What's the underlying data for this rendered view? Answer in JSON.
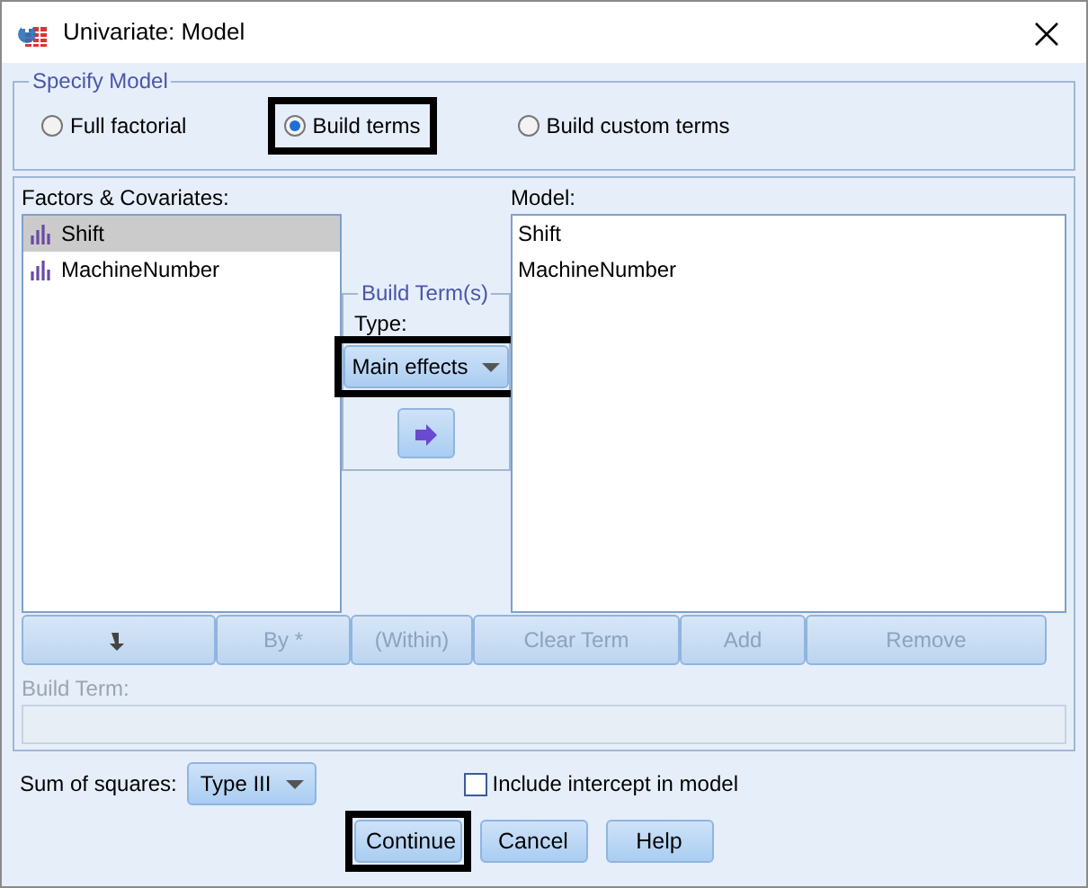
{
  "window": {
    "title": "Univariate: Model"
  },
  "specify_model": {
    "legend": "Specify Model",
    "options": [
      {
        "label": "Full factorial",
        "selected": false,
        "highlighted": false
      },
      {
        "label": "Build terms",
        "selected": true,
        "highlighted": true
      },
      {
        "label": "Build custom terms",
        "selected": false,
        "highlighted": false
      }
    ]
  },
  "factors": {
    "label": "Factors & Covariates:",
    "items": [
      {
        "label": "Shift",
        "selected": true
      },
      {
        "label": "MachineNumber",
        "selected": false
      }
    ]
  },
  "build_terms": {
    "legend": "Build Term(s)",
    "type_label": "Type:",
    "type_value": "Main effects",
    "highlighted": true
  },
  "model": {
    "label": "Model:",
    "items": [
      {
        "label": "Shift"
      },
      {
        "label": "MachineNumber"
      }
    ]
  },
  "term_buttons": [
    {
      "kind": "arrow",
      "disabled": true
    },
    {
      "kind": "text",
      "label": "By *",
      "disabled": true
    },
    {
      "kind": "text",
      "label": "(Within)",
      "disabled": true
    },
    {
      "kind": "text",
      "label": "Clear Term",
      "disabled": true
    },
    {
      "kind": "text",
      "label": "Add",
      "disabled": true
    },
    {
      "kind": "text",
      "label": "Remove",
      "disabled": true
    }
  ],
  "build_term": {
    "label": "Build Term:",
    "disabled": true
  },
  "sum_of_squares": {
    "label": "Sum of squares:",
    "value": "Type III"
  },
  "include_intercept": {
    "label": "Include intercept in model",
    "checked": false
  },
  "buttons": [
    {
      "label": "Continue",
      "highlighted": true
    },
    {
      "label": "Cancel",
      "highlighted": false
    },
    {
      "label": "Help",
      "highlighted": false
    }
  ]
}
